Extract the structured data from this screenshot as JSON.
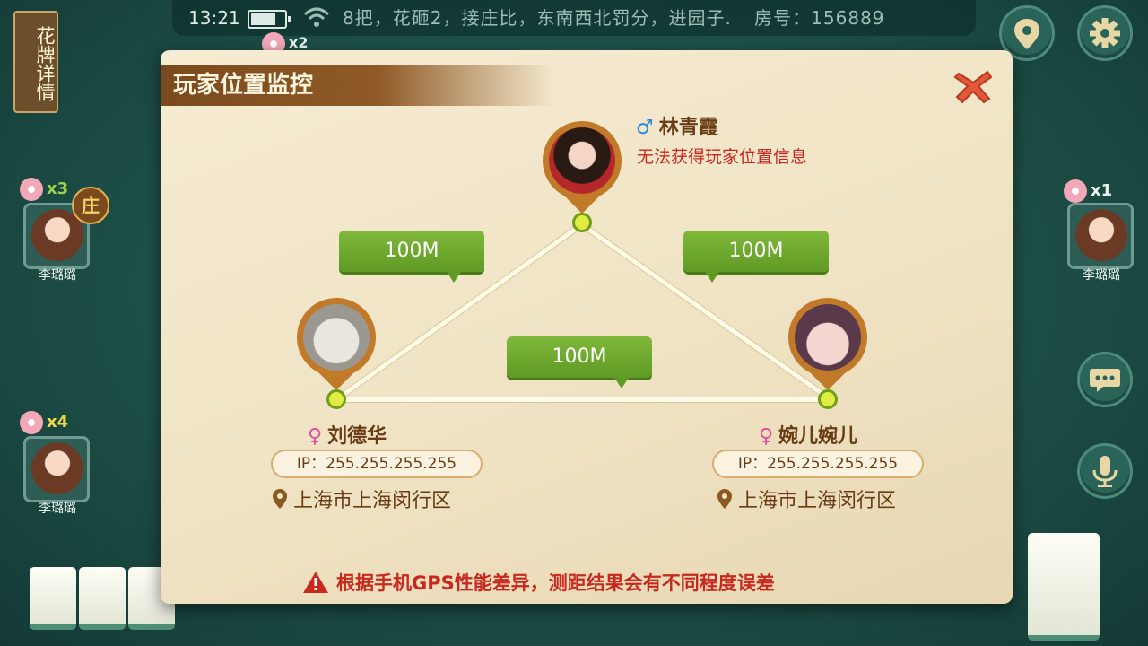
{
  "status_bar": {
    "time": "13:21",
    "rules": "8把，花砸2，接庄比，东南西北罚分，进园子.",
    "room_label": "房号：156889"
  },
  "left_panel": {
    "flower_info": "花牌详情"
  },
  "players_table": {
    "top": {
      "count": "x2",
      "name": "李璐璐"
    },
    "left_upper": {
      "count": "x3",
      "name": "李璐璐",
      "dealer_badge": "庄"
    },
    "left_lower": {
      "count": "x4",
      "name": "李璐璐"
    },
    "right": {
      "count": "x1",
      "name": "李璐璐"
    }
  },
  "modal": {
    "title": "玩家位置监控",
    "players": [
      {
        "gender": "♂",
        "name": "林青霞",
        "status": "无法获得玩家位置信息"
      },
      {
        "gender": "♀",
        "name": "刘德华",
        "ip": "IP：255.255.255.255",
        "location": "上海市上海闵行区"
      },
      {
        "gender": "♀",
        "name": "婉儿婉儿",
        "ip": "IP：255.255.255.255",
        "location": "上海市上海闵行区"
      }
    ],
    "distances": {
      "top_left": "100M",
      "top_right": "100M",
      "bottom": "100M"
    },
    "warning": "根据手机GPS性能差异，测距结果会有不同程度误差"
  },
  "colors": {
    "accent_green": "#6aa72c",
    "title_brown": "#7a4a1e",
    "warning_red": "#c8291f"
  },
  "icons": [
    "location-icon",
    "settings-icon",
    "chat-icon",
    "microphone-icon",
    "close-icon",
    "warning-icon",
    "map-pin-icon"
  ]
}
